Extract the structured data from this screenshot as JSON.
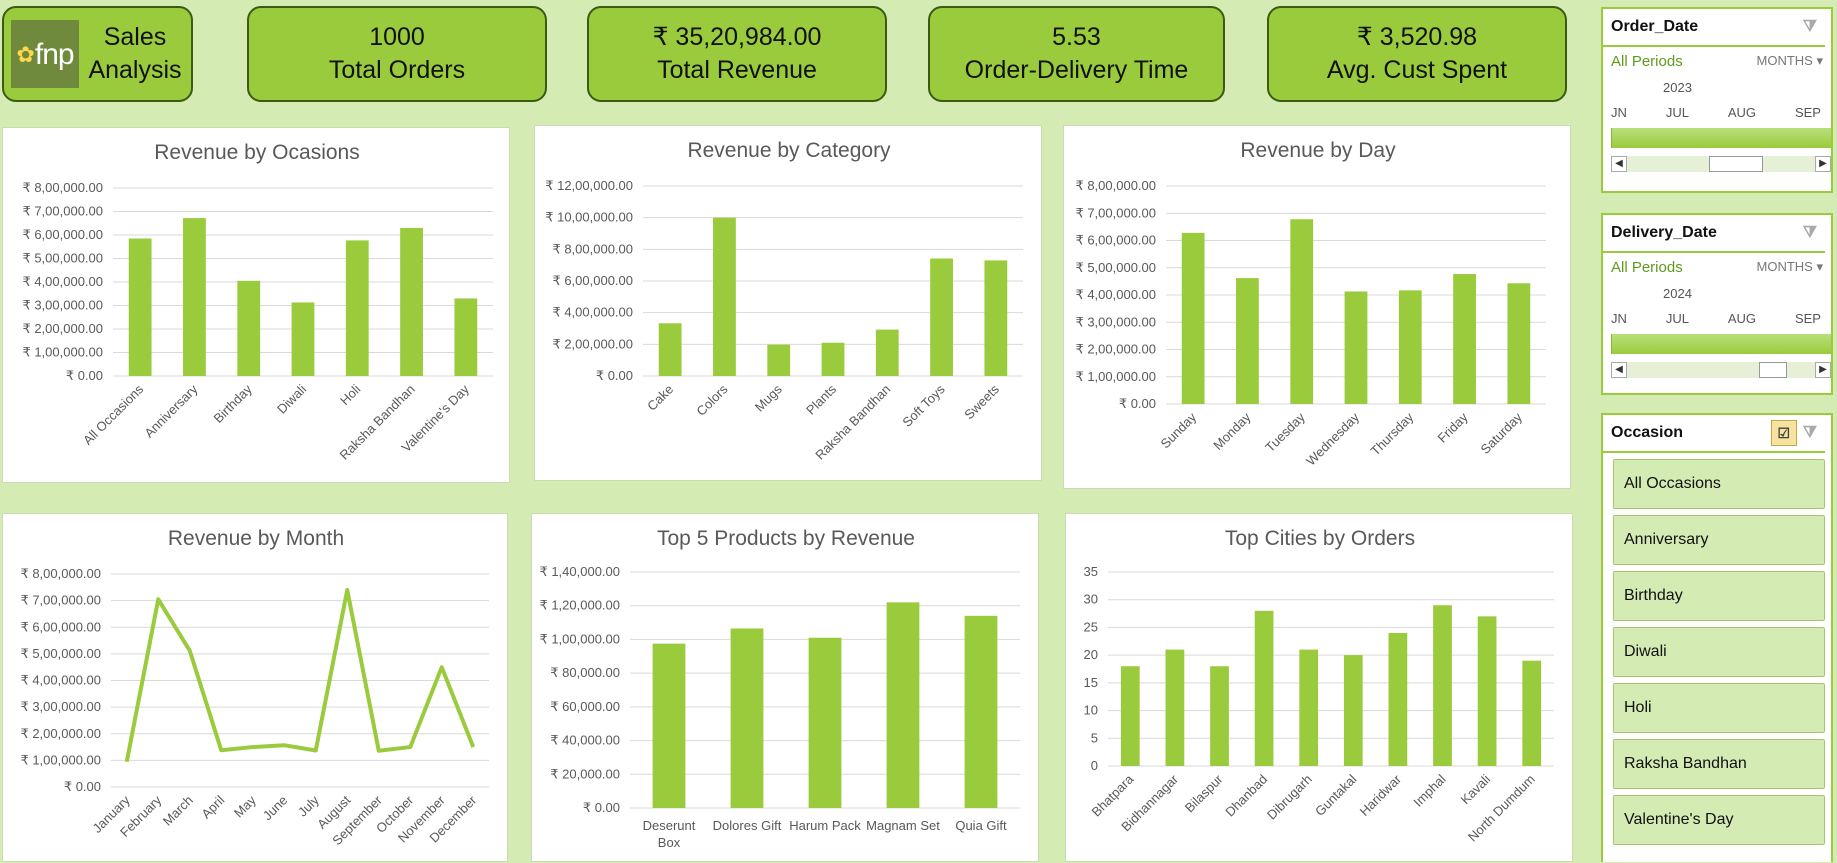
{
  "header": {
    "logo_text": "fnp",
    "title_line1": "Sales",
    "title_line2": "Analysis"
  },
  "kpis": [
    {
      "value": "1000",
      "label": "Total Orders"
    },
    {
      "value": "₹ 35,20,984.00",
      "label": "Total Revenue"
    },
    {
      "value": "5.53",
      "label": "Order-Delivery Time"
    },
    {
      "value": "₹ 3,520.98",
      "label": "Avg. Cust Spent"
    }
  ],
  "colors": {
    "accent": "#9acb3c",
    "background": "#d5ebb4",
    "border": "#3b5a14"
  },
  "chart_data": [
    {
      "type": "bar",
      "title": "Revenue by Ocasions",
      "categories": [
        "All Occasions",
        "Anniversary",
        "Birthday",
        "Diwali",
        "Holi",
        "Raksha Bandhan",
        "Valentine's Day"
      ],
      "values": [
        585000,
        672000,
        405000,
        313000,
        577000,
        630000,
        330000
      ],
      "ylim": [
        0,
        800000
      ],
      "yticks": [
        0,
        100000,
        200000,
        300000,
        400000,
        500000,
        600000,
        700000,
        800000
      ],
      "ytick_labels": [
        "₹ 0.00",
        "₹ 1,00,000.00",
        "₹ 2,00,000.00",
        "₹ 3,00,000.00",
        "₹ 4,00,000.00",
        "₹ 5,00,000.00",
        "₹ 6,00,000.00",
        "₹ 7,00,000.00",
        "₹ 8,00,000.00"
      ],
      "grid": true
    },
    {
      "type": "bar",
      "title": "Revenue by Category",
      "categories": [
        "Cake",
        "Colors",
        "Mugs",
        "Plants",
        "Raksha Bandhan",
        "Soft Toys",
        "Sweets"
      ],
      "values": [
        333000,
        1000000,
        198000,
        210000,
        293000,
        742000,
        730000
      ],
      "ylim": [
        0,
        1200000
      ],
      "yticks": [
        0,
        200000,
        400000,
        600000,
        800000,
        1000000,
        1200000
      ],
      "ytick_labels": [
        "₹ 0.00",
        "₹ 2,00,000.00",
        "₹ 4,00,000.00",
        "₹ 6,00,000.00",
        "₹ 8,00,000.00",
        "₹ 10,00,000.00",
        "₹ 12,00,000.00"
      ],
      "grid": true
    },
    {
      "type": "bar",
      "title": "Revenue by Day",
      "categories": [
        "Sunday",
        "Monday",
        "Tuesday",
        "Wednesday",
        "Thursday",
        "Friday",
        "Saturday"
      ],
      "values": [
        628000,
        462000,
        678000,
        413000,
        417000,
        477000,
        443000
      ],
      "ylim": [
        0,
        800000
      ],
      "yticks": [
        0,
        100000,
        200000,
        300000,
        400000,
        500000,
        600000,
        700000,
        800000
      ],
      "ytick_labels": [
        "₹ 0.00",
        "₹ 1,00,000.00",
        "₹ 2,00,000.00",
        "₹ 3,00,000.00",
        "₹ 4,00,000.00",
        "₹ 5,00,000.00",
        "₹ 6,00,000.00",
        "₹ 7,00,000.00",
        "₹ 8,00,000.00"
      ],
      "grid": true
    },
    {
      "type": "line",
      "title": "Revenue by Month",
      "categories": [
        "January",
        "February",
        "March",
        "April",
        "May",
        "June",
        "July",
        "August",
        "September",
        "October",
        "November",
        "December"
      ],
      "values": [
        95000,
        705000,
        512000,
        138000,
        150000,
        157000,
        137000,
        740000,
        136000,
        150000,
        450000,
        150000
      ],
      "ylim": [
        0,
        800000
      ],
      "yticks": [
        0,
        100000,
        200000,
        300000,
        400000,
        500000,
        600000,
        700000,
        800000
      ],
      "ytick_labels": [
        "₹ 0.00",
        "₹ 1,00,000.00",
        "₹ 2,00,000.00",
        "₹ 3,00,000.00",
        "₹ 4,00,000.00",
        "₹ 5,00,000.00",
        "₹ 6,00,000.00",
        "₹ 7,00,000.00",
        "₹ 8,00,000.00"
      ],
      "grid": true
    },
    {
      "type": "bar",
      "title": "Top 5 Products by Revenue",
      "categories": [
        "Deserunt Box",
        "Dolores Gift",
        "Harum Pack",
        "Magnam Set",
        "Quia Gift"
      ],
      "values": [
        97500,
        106500,
        101000,
        122000,
        114000
      ],
      "ylim": [
        0,
        140000
      ],
      "yticks": [
        0,
        20000,
        40000,
        60000,
        80000,
        100000,
        120000,
        140000
      ],
      "ytick_labels": [
        "₹ 0.00",
        "₹ 20,000.00",
        "₹ 40,000.00",
        "₹ 60,000.00",
        "₹ 80,000.00",
        "₹ 1,00,000.00",
        "₹ 1,20,000.00",
        "₹ 1,40,000.00"
      ],
      "grid": true
    },
    {
      "type": "bar",
      "title": "Top Cities by Orders",
      "categories": [
        "Bhatpara",
        "Bidhannagar",
        "Bilaspur",
        "Dhanbad",
        "Dibrugarh",
        "Guntakal",
        "Haridwar",
        "Imphal",
        "Kavali",
        "North Dumdum"
      ],
      "values": [
        18,
        21,
        18,
        28,
        21,
        20,
        24,
        29,
        27,
        19
      ],
      "ylim": [
        0,
        35
      ],
      "yticks": [
        0,
        5,
        10,
        15,
        20,
        25,
        30,
        35
      ],
      "ytick_labels": [
        "0",
        "5",
        "10",
        "15",
        "20",
        "25",
        "30",
        "35"
      ],
      "grid": true
    }
  ],
  "slicers": {
    "order_date": {
      "title": "Order_Date",
      "period": "All Periods",
      "unit": "MONTHS",
      "year": "2023",
      "months": [
        "JN",
        "JUL",
        "AUG",
        "SEP"
      ],
      "range_fraction": 1.0
    },
    "delivery_date": {
      "title": "Delivery_Date",
      "period": "All Periods",
      "unit": "MONTHS",
      "year": "2024",
      "months": [
        "JN",
        "JUL",
        "AUG",
        "SEP"
      ],
      "range_fraction": 1.0
    },
    "occasion": {
      "title": "Occasion",
      "items": [
        "All Occasions",
        "Anniversary",
        "Birthday",
        "Diwali",
        "Holi",
        "Raksha Bandhan",
        "Valentine's Day"
      ]
    }
  }
}
